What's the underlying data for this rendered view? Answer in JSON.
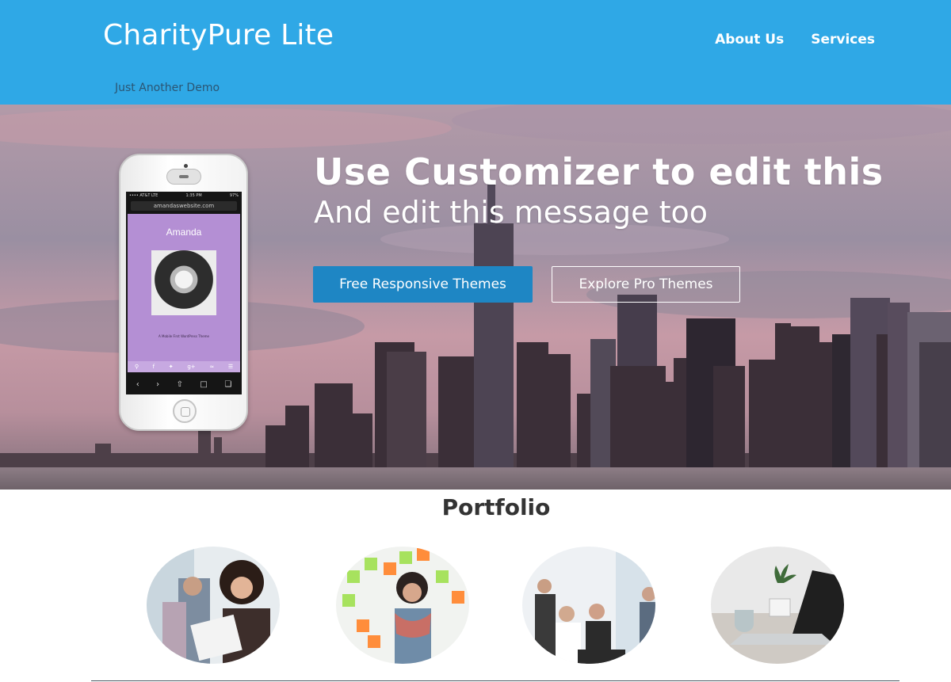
{
  "header": {
    "site_title": "CharityPure Lite",
    "site_description": "Just Another Demo",
    "nav": [
      {
        "label": "About Us"
      },
      {
        "label": "Services"
      }
    ],
    "background_color": "#2fa8e6"
  },
  "hero": {
    "headline": "Use Customizer to edit this",
    "subheadline": "And edit this message too",
    "primary_button": "Free Responsive Themes",
    "secondary_button": "Explore Pro Themes",
    "primary_button_color": "#1e86c4",
    "phone": {
      "url": "amandaswebsite.com",
      "status_left": "•••• AT&T LTE",
      "status_time": "1:35 PM",
      "status_right": "97%",
      "profile_name": "Amanda",
      "tagline": "A Mobile First WordPress Theme",
      "social_icons": [
        "search-icon",
        "facebook-icon",
        "twitter-icon",
        "google-plus-icon",
        "rss-icon",
        "menu-icon"
      ],
      "toolbar_icons": [
        "back-icon",
        "forward-icon",
        "share-icon",
        "bookmarks-icon",
        "tabs-icon"
      ]
    }
  },
  "portfolio": {
    "title": "Portfolio",
    "items": [
      {
        "icon": "office-women-reading-photo"
      },
      {
        "icon": "sticky-notes-woman-photo"
      },
      {
        "icon": "office-meeting-photo"
      },
      {
        "icon": "laptop-desk-plant-photo"
      }
    ]
  }
}
